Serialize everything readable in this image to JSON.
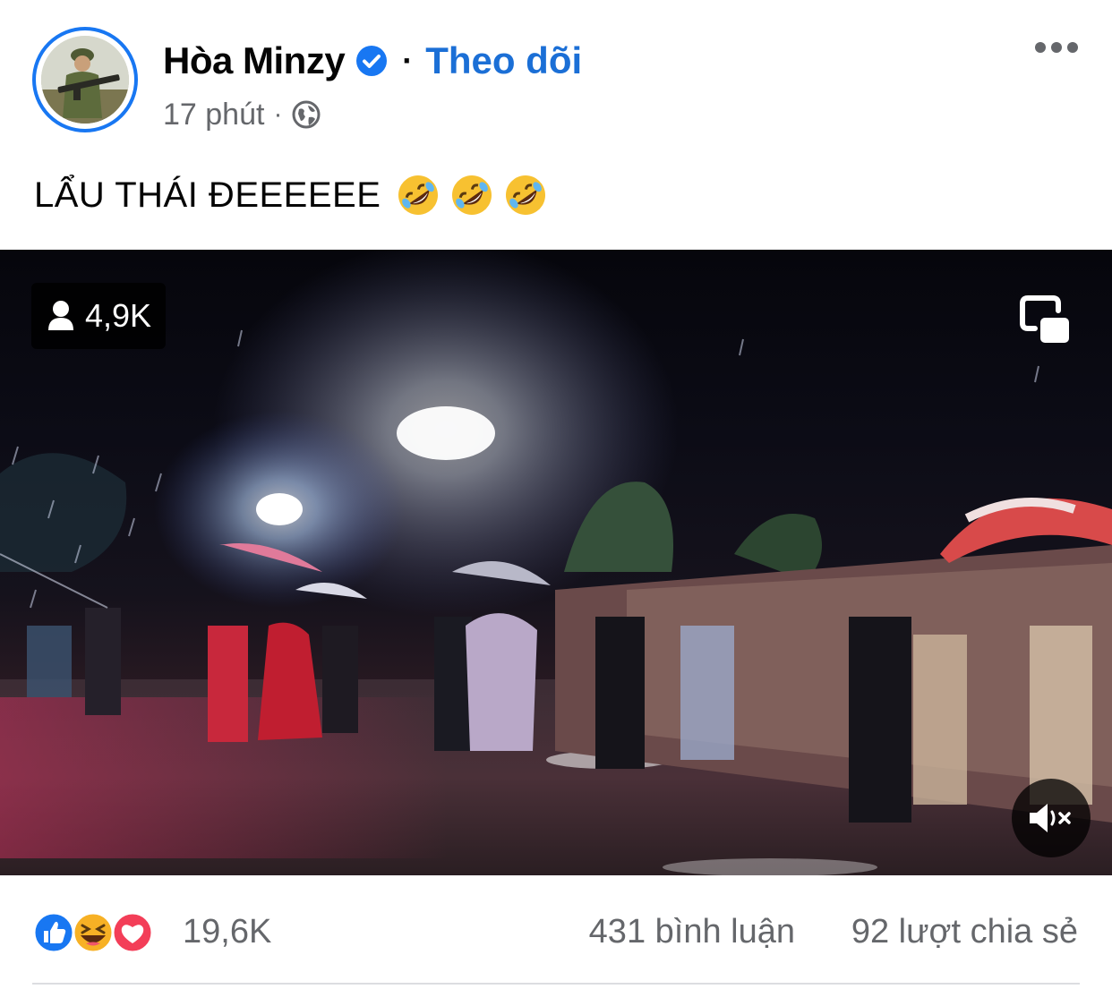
{
  "post": {
    "author": "Hòa Minzy",
    "follow_label": "Theo dõi",
    "separator": "·",
    "time": "17 phút",
    "meta_separator": "·",
    "privacy_icon": "globe-icon",
    "text": "LẨU THÁI ĐEEEEEE",
    "text_emojis": [
      "rolling-on-floor-laughing-emoji",
      "rolling-on-floor-laughing-emoji",
      "rolling-on-floor-laughing-emoji"
    ]
  },
  "video": {
    "viewer_count": "4,9K",
    "viewer_icon": "person-icon",
    "pip_icon": "picture-in-picture-icon",
    "mute_icon": "speaker-muted-icon"
  },
  "stats": {
    "reaction_icons": [
      "like-icon",
      "haha-icon",
      "love-icon"
    ],
    "reaction_count": "19,6K",
    "comments": "431 bình luận",
    "shares": "92 lượt chia sẻ"
  },
  "colors": {
    "accent": "#1877f2",
    "follow_text": "#1b6fd6",
    "secondary_text": "#65676b",
    "love": "#f33e58",
    "haha": "#f7b125"
  }
}
